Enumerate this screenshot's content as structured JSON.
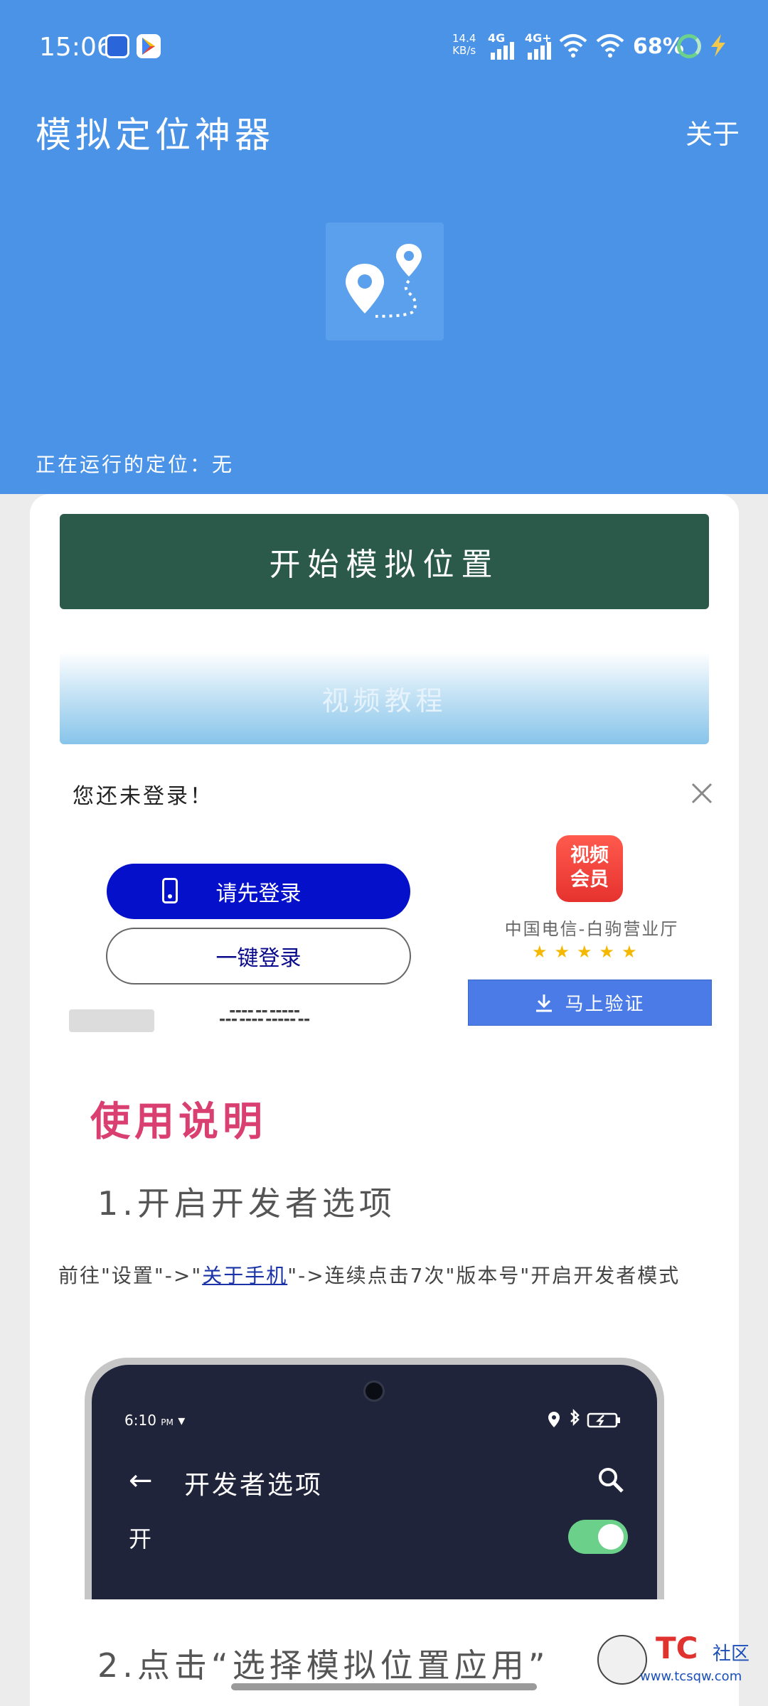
{
  "status": {
    "time": "15:06",
    "speed_top": "14.4",
    "speed_bottom": "KB/s",
    "sig1": "4G",
    "sig2": "4G+",
    "battery": "68%"
  },
  "header": {
    "title": "模拟定位神器",
    "about": "关于",
    "running_label": "正在运行的定位：",
    "running_value": "无"
  },
  "actions": {
    "start": "开始模拟位置",
    "video": "视频教程"
  },
  "ad": {
    "message": "您还未登录！",
    "login": "请先登录",
    "onekey": "一键登录",
    "vip_line1": "视频",
    "vip_line2": "会员",
    "shop": "中国电信-白驹营业厅",
    "stars": "★★★★★",
    "verify": "马上验证"
  },
  "usage": {
    "title": "使用说明",
    "step1": "1.开启开发者选项",
    "desc_pre": "前往\"设置\"->\"",
    "desc_link": "关于手机",
    "desc_post": "\"->连续点击7次\"版本号\"开启开发者模式",
    "step2": "2.点击“选择模拟位置应用”"
  },
  "phone_mock": {
    "time": "6:10",
    "time_suffix": "PM",
    "title": "开发者选项",
    "on_label": "开"
  },
  "watermark": {
    "tc": "TC",
    "club": "社区",
    "url": "www.tcsqw.com"
  },
  "colors": {
    "header_blue": "#4b93e6",
    "start_green": "#2b5a4b",
    "usage_pink": "#d93f70",
    "login_blue": "#0410c9"
  }
}
